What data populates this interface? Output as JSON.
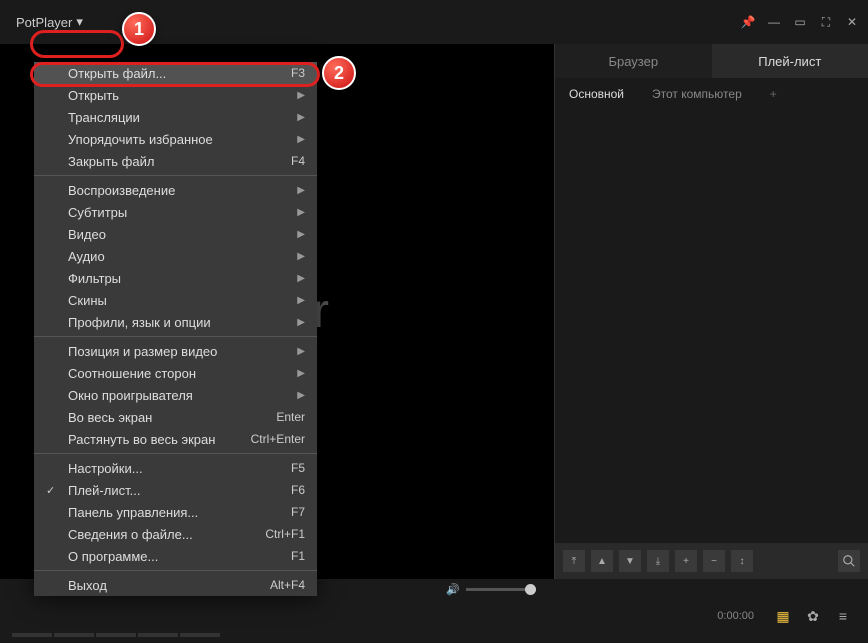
{
  "titlebar": {
    "app_label": "PotPlayer"
  },
  "menu": {
    "items": [
      {
        "label": "Открыть файл...",
        "hotkey": "F3",
        "highlight": true
      },
      {
        "label": "Открыть",
        "submenu": true
      },
      {
        "label": "Трансляции",
        "submenu": true
      },
      {
        "label": "Упорядочить избранное",
        "submenu": true
      },
      {
        "label": "Закрыть файл",
        "hotkey": "F4"
      },
      {
        "sep": true
      },
      {
        "label": "Воспроизведение",
        "submenu": true
      },
      {
        "label": "Субтитры",
        "submenu": true
      },
      {
        "label": "Видео",
        "submenu": true
      },
      {
        "label": "Аудио",
        "submenu": true
      },
      {
        "label": "Фильтры",
        "submenu": true
      },
      {
        "label": "Скины",
        "submenu": true
      },
      {
        "label": "Профили, язык и опции",
        "submenu": true
      },
      {
        "sep": true
      },
      {
        "label": "Позиция и размер видео",
        "submenu": true
      },
      {
        "label": "Соотношение сторон",
        "submenu": true
      },
      {
        "label": "Окно проигрывателя",
        "submenu": true
      },
      {
        "label": "Во весь экран",
        "hotkey": "Enter"
      },
      {
        "label": "Растянуть во весь экран",
        "hotkey": "Ctrl+Enter"
      },
      {
        "sep": true
      },
      {
        "label": "Настройки...",
        "hotkey": "F5"
      },
      {
        "label": "Плей-лист...",
        "hotkey": "F6",
        "checked": true
      },
      {
        "label": "Панель управления...",
        "hotkey": "F7"
      },
      {
        "label": "Сведения о файле...",
        "hotkey": "Ctrl+F1"
      },
      {
        "label": "О программе...",
        "hotkey": "F1"
      },
      {
        "sep": true
      },
      {
        "label": "Выход",
        "hotkey": "Alt+F4"
      }
    ]
  },
  "video": {
    "watermark": "layer"
  },
  "side": {
    "tab_browser": "Браузер",
    "tab_playlist": "Плей-лист",
    "sub_main": "Основной",
    "sub_computer": "Этот компьютер",
    "sub_plus": "+"
  },
  "bottom": {
    "time": "0:00:00"
  },
  "annot": {
    "one": "1",
    "two": "2"
  }
}
